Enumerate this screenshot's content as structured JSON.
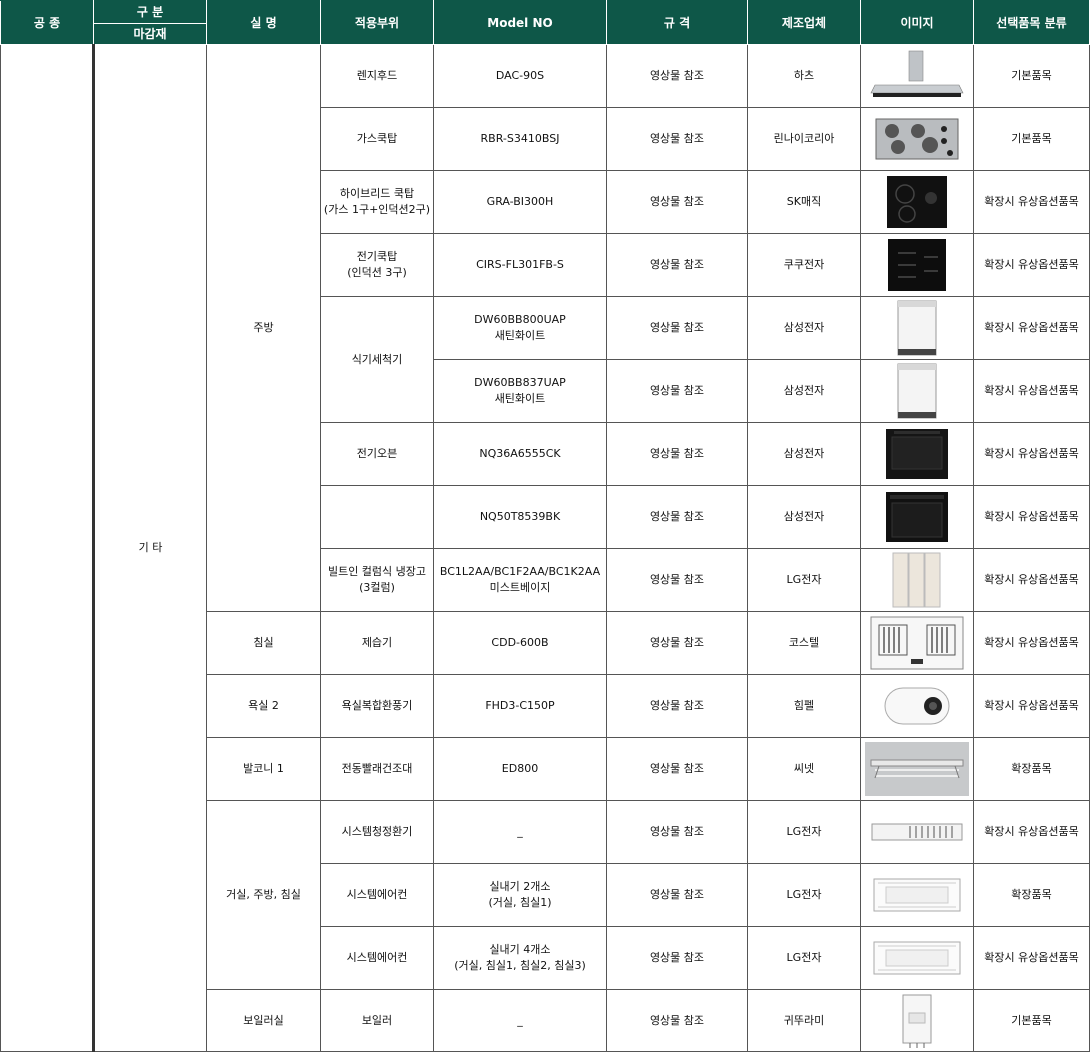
{
  "headers": {
    "trade": "공 종",
    "category_top": "구 분",
    "category_bottom": "마감재",
    "room": "실 명",
    "location": "적용부위",
    "model": "Model NO",
    "spec": "규 격",
    "maker": "제조업체",
    "image": "이미지",
    "option": "선택품목 분류"
  },
  "category": "기 타",
  "rooms": {
    "kitchen": "주방",
    "bedroom": "침실",
    "bath2": "욕실 2",
    "balcony1": "발코니 1",
    "living": "거실, 주방, 침실",
    "boiler_room": "보일러실"
  },
  "rows": [
    {
      "location": "렌지후드",
      "model": "DAC-90S",
      "spec": "영상물 참조",
      "maker": "하츠",
      "image": "range-hood-image",
      "option": "기본품목"
    },
    {
      "location": "가스쿡탑",
      "model": "RBR-S3410BSJ",
      "spec": "영상물 참조",
      "maker": "린나이코리아",
      "image": "gas-cooktop-image",
      "option": "기본품목"
    },
    {
      "location": "하이브리드 쿡탑\n(가스 1구+인덕션2구)",
      "model": "GRA-BI300H",
      "spec": "영상물 참조",
      "maker": "SK매직",
      "image": "hybrid-cooktop-image",
      "option": "확장시 유상옵션품목"
    },
    {
      "location": "전기쿡탑\n(인덕션 3구)",
      "model": "CIRS-FL301FB-S",
      "spec": "영상물 참조",
      "maker": "쿠쿠전자",
      "image": "induction-cooktop-image",
      "option": "확장시 유상옵션품목"
    },
    {
      "location": "식기세척기",
      "model": "DW60BB800UAP\n새틴화이트",
      "spec": "영상물 참조",
      "maker": "삼성전자",
      "image": "dishwasher-image",
      "option": "확장시 유상옵션품목"
    },
    {
      "model": "DW60BB837UAP\n새틴화이트",
      "spec": "영상물 참조",
      "maker": "삼성전자",
      "image": "dishwasher-image",
      "option": "확장시 유상옵션품목"
    },
    {
      "location": "전기오븐",
      "model": "NQ36A6555CK",
      "spec": "영상물 참조",
      "maker": "삼성전자",
      "image": "microwave-oven-image",
      "option": "확장시 유상옵션품목"
    },
    {
      "location": "",
      "model": "NQ50T8539BK",
      "spec": "영상물 참조",
      "maker": "삼성전자",
      "image": "built-in-oven-image",
      "option": "확장시 유상옵션품목"
    },
    {
      "location": "빌트인 컬럼식 냉장고\n(3컬럼)",
      "model": "BC1L2AA/BC1F2AA/BC1K2AA\n미스트베이지",
      "spec": "영상물 참조",
      "maker": "LG전자",
      "image": "column-refrigerator-image",
      "option": "확장시 유상옵션품목"
    },
    {
      "location": "제습기",
      "model": "CDD-600B",
      "spec": "영상물 참조",
      "maker": "코스텔",
      "image": "dehumidifier-image",
      "option": "확장시 유상옵션품목"
    },
    {
      "location": "욕실복합환풍기",
      "model": "FHD3-C150P",
      "spec": "영상물 참조",
      "maker": "힘펠",
      "image": "bath-fan-image",
      "option": "확장시 유상옵션품목"
    },
    {
      "location": "전동빨래건조대",
      "model": "ED800",
      "spec": "영상물 참조",
      "maker": "씨넷",
      "image": "laundry-rack-image",
      "option": "확장품목"
    },
    {
      "location": "시스템청정환기",
      "model": "_",
      "spec": "영상물 참조",
      "maker": "LG전자",
      "image": "ventilation-unit-image",
      "option": "확장시 유상옵션품목"
    },
    {
      "location": "시스템에어컨",
      "model": "실내기 2개소\n(거실, 침실1)",
      "spec": "영상물 참조",
      "maker": "LG전자",
      "image": "ceiling-aircon-image",
      "option": "확장품목"
    },
    {
      "location": "시스템에어컨",
      "model": "실내기 4개소\n(거실, 침실1, 침실2, 침실3)",
      "spec": "영상물 참조",
      "maker": "LG전자",
      "image": "ceiling-aircon-image",
      "option": "확장시 유상옵션품목"
    },
    {
      "location": "보일러",
      "model": "_",
      "spec": "영상물 참조",
      "maker": "귀뚜라미",
      "image": "boiler-image",
      "option": "기본품목"
    }
  ]
}
